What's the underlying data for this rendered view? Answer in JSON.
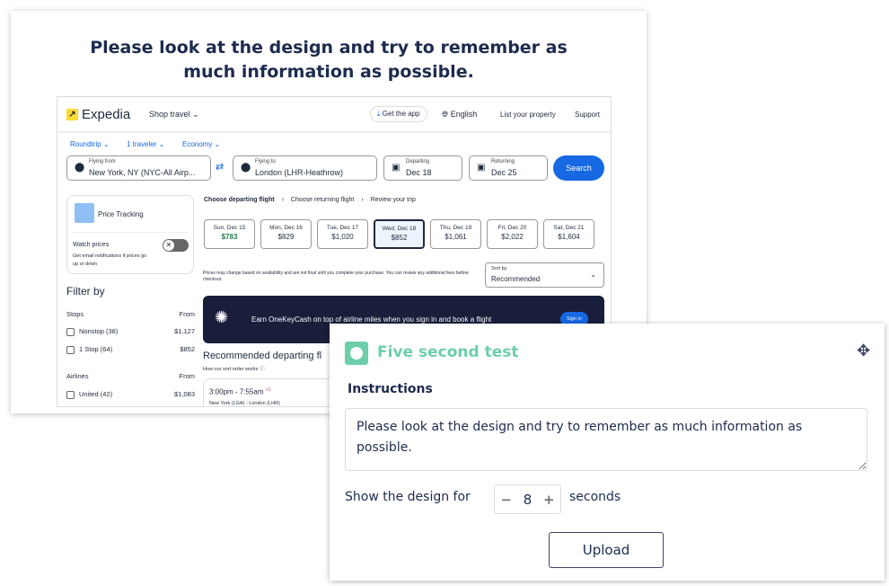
{
  "prompt": {
    "line1": "Please look at the design and try to remember as",
    "line2": "much information as possible."
  },
  "expedia": {
    "logo": "Expedia",
    "shop_travel": "Shop travel ⌄",
    "get_app": "Get the app",
    "english": "English",
    "list_property": "List your property",
    "support": "Support",
    "trip_type": "Roundtrip ⌄",
    "travelers": "1 traveler ⌄",
    "cabin": "Economy ⌄",
    "from_label": "Flying from",
    "from_value": "New York, NY (NYC-All Airp...",
    "to_label": "Flying to",
    "to_value": "London (LHR-Heathrow)",
    "depart_label": "Departing",
    "depart_value": "Dec 18",
    "return_label": "Returning",
    "return_value": "Dec 25",
    "search": "Search",
    "price_tracking": "Price Tracking",
    "watch_prices": "Watch prices",
    "watch_desc": "Get email notifications if prices go up or down",
    "steps": [
      "Choose departing flight",
      "Choose returning flight",
      "Review your trip"
    ],
    "dates": [
      {
        "day": "Sun, Dec 15",
        "price": "$783"
      },
      {
        "day": "Mon, Dec 16",
        "price": "$829"
      },
      {
        "day": "Tue, Dec 17",
        "price": "$1,020"
      },
      {
        "day": "Wed, Dec 18",
        "price": "$852"
      },
      {
        "day": "Thu, Dec 19",
        "price": "$1,061"
      },
      {
        "day": "Fri, Dec 20",
        "price": "$2,022"
      },
      {
        "day": "Sat, Dec 21",
        "price": "$1,604"
      }
    ],
    "disclaimer": "Prices may change based on availability and are not final until you complete your purchase. You can review any additional fees before checkout.",
    "sort_label": "Sort by",
    "sort_value": "Recommended",
    "filter_by": "Filter by",
    "stops": "Stops",
    "from": "From",
    "stop_options": [
      {
        "label": "Nonstop (38)",
        "price": "$1,127"
      },
      {
        "label": "1 Stop (64)",
        "price": "$852"
      }
    ],
    "airlines": "Airlines",
    "airline_options": [
      {
        "label": "United (42)",
        "price": "$1,083"
      }
    ],
    "banner": "Earn OneKeyCash on top of airline miles when you sign in and book a flight",
    "sign_in": "Sign in",
    "recommended": "Recommended departing fl",
    "sort_info": "How our sort order works",
    "flight_time": "3:00pm - 7:55am",
    "flight_plus": "+1",
    "flight_route": "New York (LGA) - London (LHR)"
  },
  "test": {
    "title": "Five second test",
    "instructions_label": "Instructions",
    "instructions": "Please look at the design and try to remember as much information as possible.",
    "show_for": "Show the design for",
    "seconds_value": "8",
    "seconds": "seconds",
    "upload": "Upload",
    "accent": "#6dcfaa"
  }
}
